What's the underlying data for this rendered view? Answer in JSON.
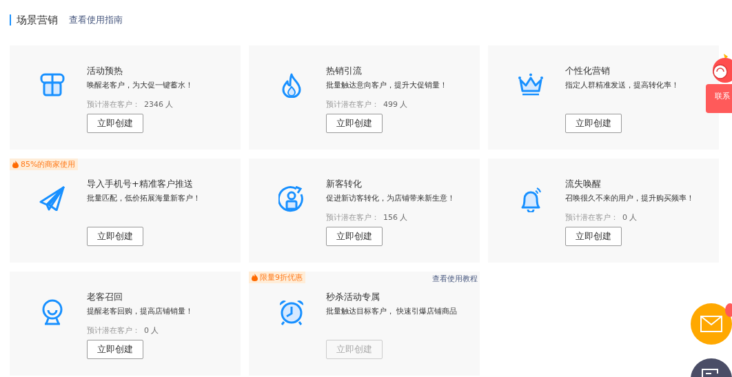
{
  "header": {
    "title": "场景营销",
    "guide_link": "查看使用指南"
  },
  "cards": [
    {
      "title": "活动预热",
      "description": "唤醒老客户，为大促一键蓄水！",
      "estimate_label": "预计潜在客户：",
      "estimate_value": "2346 人",
      "button": "立即创建",
      "disabled": false
    },
    {
      "title": "热销引流",
      "description": "批量触达意向客户，提升大促销量！",
      "estimate_label": "预计潜在客户：",
      "estimate_value": "499 人",
      "button": "立即创建",
      "disabled": false
    },
    {
      "title": "个性化营销",
      "description": "指定人群精准发送，提高转化率！",
      "button": "立即创建",
      "disabled": false
    },
    {
      "badge": "85%的商家使用",
      "title": "导入手机号+精准客户推送",
      "description": "批量匹配，低价拓展海量新客户！",
      "button": "立即创建",
      "disabled": false
    },
    {
      "title": "新客转化",
      "description": "促进新访客转化，为店铺带来新生意！",
      "estimate_label": "预计潜在客户：",
      "estimate_value": "156 人",
      "button": "立即创建",
      "disabled": false
    },
    {
      "title": "流失唤醒",
      "description": "召唤很久不来的用户，提升购买频率！",
      "estimate_label": "预计潜在客户：",
      "estimate_value": "0 人",
      "button": "立即创建",
      "disabled": false
    },
    {
      "title": "老客召回",
      "description": "提醒老客回购，提高店铺销量！",
      "estimate_label": "预计潜在客户：",
      "estimate_value": "0 人",
      "button": "立即创建",
      "disabled": false
    },
    {
      "badge": "限量9折优惠",
      "link": "查看使用教程",
      "title": "秒杀活动专属",
      "description": "批量触达目标客户， 快速引爆店铺商品",
      "button": "立即创建",
      "disabled": true
    }
  ],
  "contact_tab": {
    "label": "联系"
  }
}
